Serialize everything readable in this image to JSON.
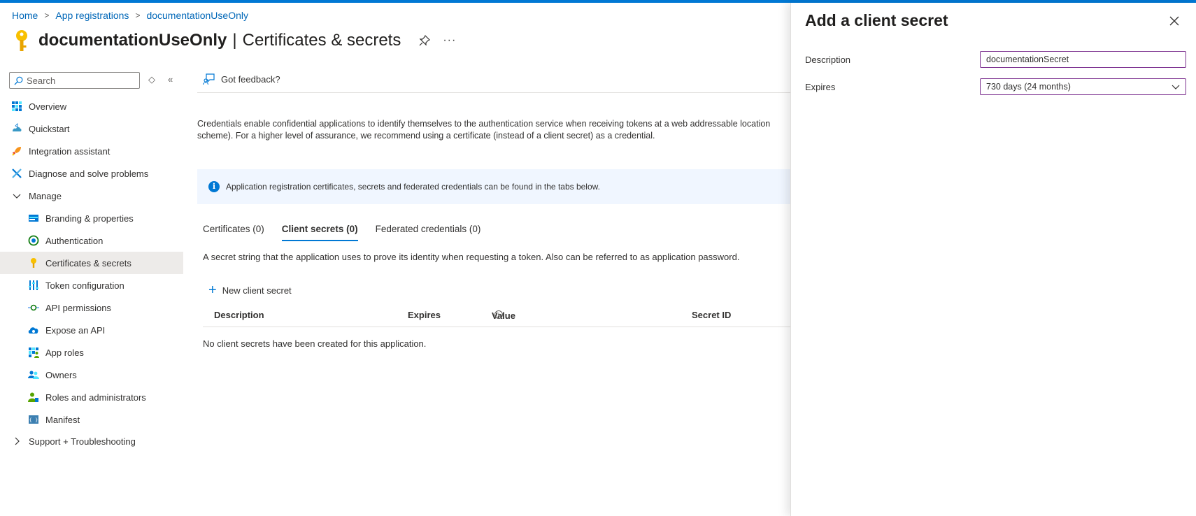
{
  "breadcrumb": {
    "items": [
      "Home",
      "App registrations",
      "documentationUseOnly"
    ]
  },
  "header": {
    "app_name": "documentationUseOnly",
    "separator": "|",
    "page_title": "Certificates & secrets",
    "more": "···"
  },
  "sidebar": {
    "search_placeholder": "Search",
    "items": [
      {
        "label": "Overview",
        "icon": "overview-icon"
      },
      {
        "label": "Quickstart",
        "icon": "quickstart-icon"
      },
      {
        "label": "Integration assistant",
        "icon": "rocket-icon"
      },
      {
        "label": "Diagnose and solve problems",
        "icon": "wrench-icon"
      },
      {
        "label": "Manage",
        "icon": "chevron-down-icon"
      },
      {
        "label": "Branding & properties",
        "icon": "branding-icon"
      },
      {
        "label": "Authentication",
        "icon": "authentication-icon"
      },
      {
        "label": "Certificates & secrets",
        "icon": "key-icon"
      },
      {
        "label": "Token configuration",
        "icon": "token-icon"
      },
      {
        "label": "API permissions",
        "icon": "api-permissions-icon"
      },
      {
        "label": "Expose an API",
        "icon": "cloud-icon"
      },
      {
        "label": "App roles",
        "icon": "app-roles-icon"
      },
      {
        "label": "Owners",
        "icon": "owners-icon"
      },
      {
        "label": "Roles and administrators",
        "icon": "roles-icon"
      },
      {
        "label": "Manifest",
        "icon": "manifest-icon"
      },
      {
        "label": "Support + Troubleshooting",
        "icon": "chevron-right-icon"
      }
    ]
  },
  "main": {
    "feedback_label": "Got feedback?",
    "intro_line1": "Credentials enable confidential applications to identify themselves to the authentication service when receiving tokens at a web addressable location",
    "intro_line2": "scheme). For a higher level of assurance, we recommend using a certificate (instead of a client secret) as a credential.",
    "info_text": "Application registration certificates, secrets and federated credentials can be found in the tabs below.",
    "tabs": [
      {
        "label": "Certificates (0)"
      },
      {
        "label": "Client secrets (0)"
      },
      {
        "label": "Federated credentials (0)"
      }
    ],
    "tab_description": "A secret string that the application uses to prove its identity when requesting a token. Also can be referred to as application password.",
    "new_secret_label": "New client secret",
    "columns": [
      "Description",
      "Expires",
      "Value",
      "Secret ID"
    ],
    "empty_message": "No client secrets have been created for this application."
  },
  "panel": {
    "title": "Add a client secret",
    "description_label": "Description",
    "description_value": "documentationSecret",
    "expires_label": "Expires",
    "expires_value": "730 days (24 months)"
  },
  "colors": {
    "accent": "#0078d4",
    "link": "#0067b8",
    "input_border": "#7b2f8e",
    "info_background": "#f0f6ff",
    "active_item": "#edebe9"
  }
}
